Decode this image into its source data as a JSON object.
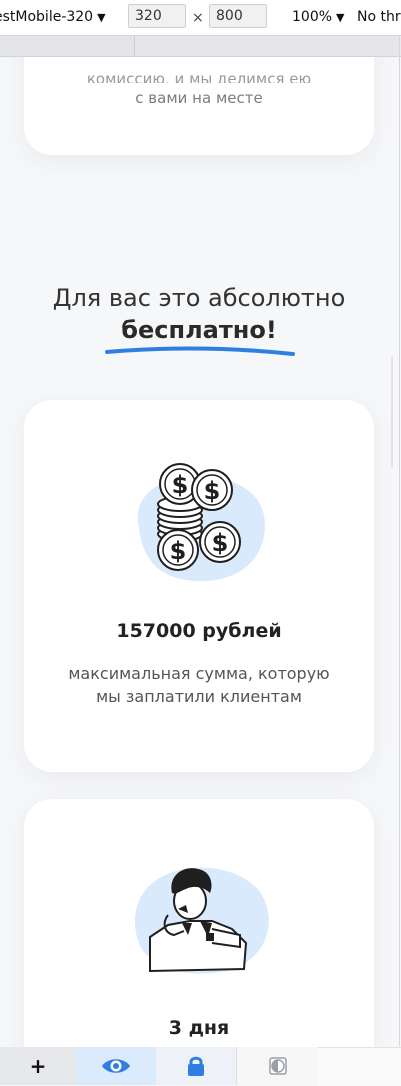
{
  "devtools": {
    "device_preset": "estMobile-320",
    "width_value": "320",
    "height_value": "800",
    "times_symbol": "×",
    "zoom": "100%",
    "throttling": "No thr",
    "caret": "▼"
  },
  "content": {
    "prev_card": {
      "cut_line": "комиссию, и мы делимся ею",
      "line2": "с вами на месте"
    },
    "headline": {
      "line1": "Для вас это абсолютно",
      "line2": "бесплатно!"
    },
    "cards": [
      {
        "illustration": "coins-stack-icon",
        "amount": "157000 рублей",
        "description": "максимальная сумма, которую мы заплатили клиентам"
      },
      {
        "illustration": "thinking-person-icon",
        "amount": "3 дня"
      }
    ]
  },
  "bottombar": {
    "plus_label": "+",
    "items": [
      "plus-icon",
      "eye-icon",
      "lock-icon",
      "contrast-icon"
    ]
  },
  "colors": {
    "accent_blue": "#2f7fe0",
    "blob_blue": "#d9eafc",
    "card_bg": "#ffffff",
    "page_bg": "#f6f7f9"
  }
}
